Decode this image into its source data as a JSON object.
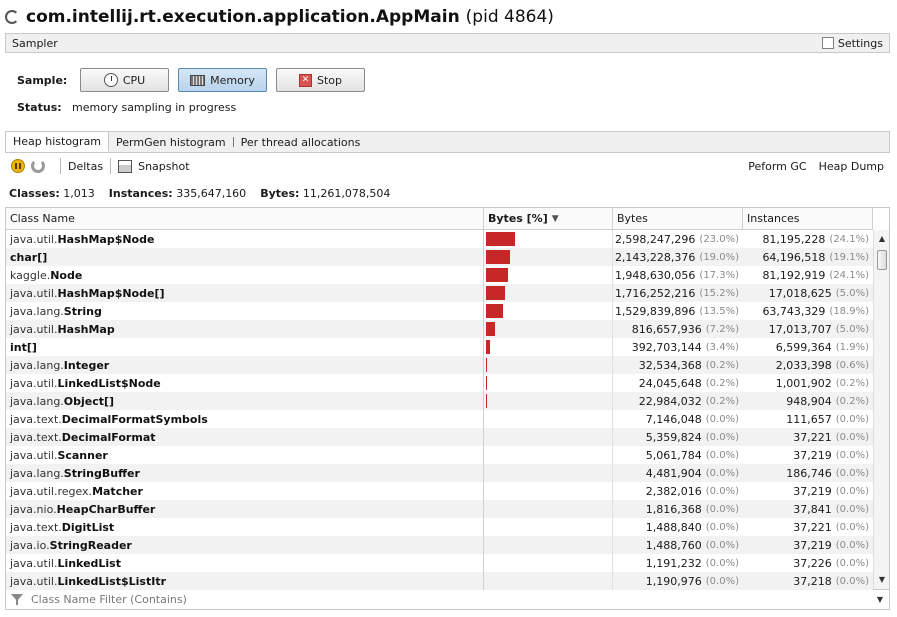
{
  "window": {
    "title_main": "com.intellij.rt.execution.application.AppMain",
    "title_pid": "(pid 4864)"
  },
  "sampler": {
    "header": "Sampler",
    "settings_label": "Settings"
  },
  "controls": {
    "sample_label": "Sample:",
    "cpu_label": "CPU",
    "memory_label": "Memory",
    "stop_label": "Stop",
    "active": "Memory"
  },
  "status": {
    "label": "Status:",
    "value": "memory sampling in progress"
  },
  "tabs": [
    {
      "label": "Heap histogram",
      "selected": true
    },
    {
      "label": "PermGen histogram",
      "selected": false
    },
    {
      "label": "Per thread allocations",
      "selected": false
    }
  ],
  "toolbar": {
    "deltas_label": "Deltas",
    "snapshot_label": "Snapshot",
    "gc_label": "Peform GC",
    "heapdump_label": "Heap Dump"
  },
  "summary": {
    "classes_label": "Classes:",
    "classes_value": "1,013",
    "instances_label": "Instances:",
    "instances_value": "335,647,160",
    "bytes_label": "Bytes:",
    "bytes_value": "11,261,078,504"
  },
  "columns": {
    "class_name": "Class Name",
    "bytes_pct": "Bytes [%]",
    "bytes": "Bytes",
    "instances": "Instances"
  },
  "rows": [
    {
      "pkg": "java.util.",
      "name": "HashMap$Node",
      "bar_pct": 23.0,
      "bytes": "2,598,247,296",
      "bytes_pct": "(23.0%)",
      "instances": "81,195,228",
      "inst_pct": "(24.1%)"
    },
    {
      "pkg": "",
      "name": "char[]",
      "bar_pct": 19.0,
      "bytes": "2,143,228,376",
      "bytes_pct": "(19.0%)",
      "instances": "64,196,518",
      "inst_pct": "(19.1%)"
    },
    {
      "pkg": "kaggle.",
      "name": "Node",
      "bar_pct": 17.3,
      "bytes": "1,948,630,056",
      "bytes_pct": "(17.3%)",
      "instances": "81,192,919",
      "inst_pct": "(24.1%)"
    },
    {
      "pkg": "java.util.",
      "name": "HashMap$Node[]",
      "bar_pct": 15.2,
      "bytes": "1,716,252,216",
      "bytes_pct": "(15.2%)",
      "instances": "17,018,625",
      "inst_pct": "(5.0%)"
    },
    {
      "pkg": "java.lang.",
      "name": "String",
      "bar_pct": 13.5,
      "bytes": "1,529,839,896",
      "bytes_pct": "(13.5%)",
      "instances": "63,743,329",
      "inst_pct": "(18.9%)"
    },
    {
      "pkg": "java.util.",
      "name": "HashMap",
      "bar_pct": 7.2,
      "bytes": "816,657,936",
      "bytes_pct": "(7.2%)",
      "instances": "17,013,707",
      "inst_pct": "(5.0%)"
    },
    {
      "pkg": "",
      "name": "int[]",
      "bar_pct": 3.4,
      "bytes": "392,703,144",
      "bytes_pct": "(3.4%)",
      "instances": "6,599,364",
      "inst_pct": "(1.9%)"
    },
    {
      "pkg": "java.lang.",
      "name": "Integer",
      "bar_pct": 0.2,
      "bytes": "32,534,368",
      "bytes_pct": "(0.2%)",
      "instances": "2,033,398",
      "inst_pct": "(0.6%)"
    },
    {
      "pkg": "java.util.",
      "name": "LinkedList$Node",
      "bar_pct": 0.2,
      "bytes": "24,045,648",
      "bytes_pct": "(0.2%)",
      "instances": "1,001,902",
      "inst_pct": "(0.2%)"
    },
    {
      "pkg": "java.lang.",
      "name": "Object[]",
      "bar_pct": 0.2,
      "bytes": "22,984,032",
      "bytes_pct": "(0.2%)",
      "instances": "948,904",
      "inst_pct": "(0.2%)"
    },
    {
      "pkg": "java.text.",
      "name": "DecimalFormatSymbols",
      "bar_pct": 0.0,
      "bytes": "7,146,048",
      "bytes_pct": "(0.0%)",
      "instances": "111,657",
      "inst_pct": "(0.0%)"
    },
    {
      "pkg": "java.text.",
      "name": "DecimalFormat",
      "bar_pct": 0.0,
      "bytes": "5,359,824",
      "bytes_pct": "(0.0%)",
      "instances": "37,221",
      "inst_pct": "(0.0%)"
    },
    {
      "pkg": "java.util.",
      "name": "Scanner",
      "bar_pct": 0.0,
      "bytes": "5,061,784",
      "bytes_pct": "(0.0%)",
      "instances": "37,219",
      "inst_pct": "(0.0%)"
    },
    {
      "pkg": "java.lang.",
      "name": "StringBuffer",
      "bar_pct": 0.0,
      "bytes": "4,481,904",
      "bytes_pct": "(0.0%)",
      "instances": "186,746",
      "inst_pct": "(0.0%)"
    },
    {
      "pkg": "java.util.regex.",
      "name": "Matcher",
      "bar_pct": 0.0,
      "bytes": "2,382,016",
      "bytes_pct": "(0.0%)",
      "instances": "37,219",
      "inst_pct": "(0.0%)"
    },
    {
      "pkg": "java.nio.",
      "name": "HeapCharBuffer",
      "bar_pct": 0.0,
      "bytes": "1,816,368",
      "bytes_pct": "(0.0%)",
      "instances": "37,841",
      "inst_pct": "(0.0%)"
    },
    {
      "pkg": "java.text.",
      "name": "DigitList",
      "bar_pct": 0.0,
      "bytes": "1,488,840",
      "bytes_pct": "(0.0%)",
      "instances": "37,221",
      "inst_pct": "(0.0%)"
    },
    {
      "pkg": "java.io.",
      "name": "StringReader",
      "bar_pct": 0.0,
      "bytes": "1,488,760",
      "bytes_pct": "(0.0%)",
      "instances": "37,219",
      "inst_pct": "(0.0%)"
    },
    {
      "pkg": "java.util.",
      "name": "LinkedList",
      "bar_pct": 0.0,
      "bytes": "1,191,232",
      "bytes_pct": "(0.0%)",
      "instances": "37,226",
      "inst_pct": "(0.0%)"
    },
    {
      "pkg": "java.util.",
      "name": "LinkedList$ListItr",
      "bar_pct": 0.0,
      "bytes": "1,190,976",
      "bytes_pct": "(0.0%)",
      "instances": "37,218",
      "inst_pct": "(0.0%)"
    }
  ],
  "filter": {
    "placeholder": "Class Name Filter (Contains)"
  },
  "icons": {
    "spinner": "spinner-icon",
    "clock": "clock-icon",
    "memory": "memory-chip-icon",
    "stop": "stop-icon",
    "pause": "pause-icon",
    "refresh": "refresh-icon",
    "snapshot": "snapshot-icon",
    "filter": "filter-icon",
    "sort": "sort-descending-icon"
  },
  "colors": {
    "bar": "#c62828",
    "memory_active": "#b8d3ec"
  }
}
